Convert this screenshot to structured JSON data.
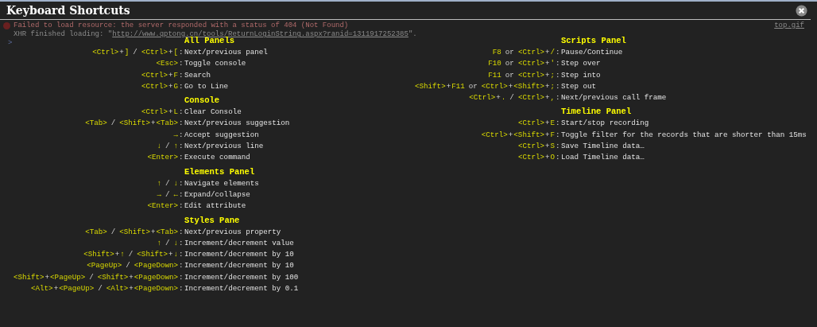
{
  "console": {
    "messages": [
      {
        "kind": "error",
        "text": "Failed to load resource: the server responded with a status of 404 (Not Found)",
        "source": "top.gif"
      },
      {
        "kind": "log",
        "text": "XHR finished loading: \"",
        "link": "http://www.qptong.cn/tools/ReturnLoginString.aspx?ranid=1311917252385",
        "after": "\"."
      }
    ],
    "prompt": ">"
  },
  "dialog": {
    "title": "Keyboard Shortcuts",
    "columns": [
      {
        "sections": [
          {
            "title": "All Panels",
            "shortcuts": [
              {
                "keys": [
                  {
                    "kind": "key",
                    "text": "<Ctrl>"
                  },
                  {
                    "kind": "sep",
                    "text": "+"
                  },
                  {
                    "kind": "key",
                    "text": "]"
                  },
                  {
                    "kind": "word",
                    "text": "/"
                  },
                  {
                    "kind": "key",
                    "text": "<Ctrl>"
                  },
                  {
                    "kind": "sep",
                    "text": "+"
                  },
                  {
                    "kind": "key",
                    "text": "["
                  }
                ],
                "separator": ":",
                "description": "Next/previous panel"
              },
              {
                "keys": [
                  {
                    "kind": "key",
                    "text": "<Esc>"
                  }
                ],
                "separator": ":",
                "description": "Toggle console"
              },
              {
                "keys": [
                  {
                    "kind": "key",
                    "text": "<Ctrl>"
                  },
                  {
                    "kind": "sep",
                    "text": "+"
                  },
                  {
                    "kind": "key",
                    "text": "F"
                  }
                ],
                "separator": ":",
                "description": "Search"
              },
              {
                "keys": [
                  {
                    "kind": "key",
                    "text": "<Ctrl>"
                  },
                  {
                    "kind": "sep",
                    "text": "+"
                  },
                  {
                    "kind": "key",
                    "text": "G"
                  }
                ],
                "separator": ":",
                "description": "Go to Line"
              }
            ]
          },
          {
            "title": "Console",
            "shortcuts": [
              {
                "keys": [
                  {
                    "kind": "key",
                    "text": "<Ctrl>"
                  },
                  {
                    "kind": "sep",
                    "text": "+"
                  },
                  {
                    "kind": "key",
                    "text": "L"
                  }
                ],
                "separator": ":",
                "description": "Clear Console"
              },
              {
                "keys": [
                  {
                    "kind": "key",
                    "text": "<Tab>"
                  },
                  {
                    "kind": "word",
                    "text": "/"
                  },
                  {
                    "kind": "key",
                    "text": "<Shift>"
                  },
                  {
                    "kind": "sep",
                    "text": "+"
                  },
                  {
                    "kind": "key",
                    "text": "<Tab>"
                  }
                ],
                "separator": ":",
                "description": "Next/previous suggestion"
              },
              {
                "keys": [
                  {
                    "kind": "key",
                    "text": "→"
                  }
                ],
                "separator": ":",
                "description": "Accept suggestion"
              },
              {
                "keys": [
                  {
                    "kind": "key",
                    "text": "↓"
                  },
                  {
                    "kind": "word",
                    "text": "/"
                  },
                  {
                    "kind": "key",
                    "text": "↑"
                  }
                ],
                "separator": ":",
                "description": "Next/previous line"
              },
              {
                "keys": [
                  {
                    "kind": "key",
                    "text": "<Enter>"
                  }
                ],
                "separator": ":",
                "description": "Execute command"
              }
            ]
          },
          {
            "title": "Elements Panel",
            "shortcuts": [
              {
                "keys": [
                  {
                    "kind": "key",
                    "text": "↑"
                  },
                  {
                    "kind": "word",
                    "text": "/"
                  },
                  {
                    "kind": "key",
                    "text": "↓"
                  }
                ],
                "separator": ":",
                "description": "Navigate elements"
              },
              {
                "keys": [
                  {
                    "kind": "key",
                    "text": "→"
                  },
                  {
                    "kind": "word",
                    "text": "/"
                  },
                  {
                    "kind": "key",
                    "text": "←"
                  }
                ],
                "separator": ":",
                "description": "Expand/collapse"
              },
              {
                "keys": [
                  {
                    "kind": "key",
                    "text": "<Enter>"
                  }
                ],
                "separator": ":",
                "description": "Edit attribute"
              }
            ]
          },
          {
            "title": "Styles Pane",
            "shortcuts": [
              {
                "keys": [
                  {
                    "kind": "key",
                    "text": "<Tab>"
                  },
                  {
                    "kind": "word",
                    "text": "/"
                  },
                  {
                    "kind": "key",
                    "text": "<Shift>"
                  },
                  {
                    "kind": "sep",
                    "text": "+"
                  },
                  {
                    "kind": "key",
                    "text": "<Tab>"
                  }
                ],
                "separator": ":",
                "description": "Next/previous property"
              },
              {
                "keys": [
                  {
                    "kind": "key",
                    "text": "↑"
                  },
                  {
                    "kind": "word",
                    "text": "/"
                  },
                  {
                    "kind": "key",
                    "text": "↓"
                  }
                ],
                "separator": ":",
                "description": "Increment/decrement value"
              },
              {
                "keys": [
                  {
                    "kind": "key",
                    "text": "<Shift>"
                  },
                  {
                    "kind": "sep",
                    "text": "+"
                  },
                  {
                    "kind": "key",
                    "text": "↑"
                  },
                  {
                    "kind": "word",
                    "text": "/"
                  },
                  {
                    "kind": "key",
                    "text": "<Shift>"
                  },
                  {
                    "kind": "sep",
                    "text": "+"
                  },
                  {
                    "kind": "key",
                    "text": "↓"
                  }
                ],
                "separator": ":",
                "description": "Increment/decrement by 10"
              },
              {
                "keys": [
                  {
                    "kind": "key",
                    "text": "<PageUp>"
                  },
                  {
                    "kind": "word",
                    "text": "/"
                  },
                  {
                    "kind": "key",
                    "text": "<PageDown>"
                  }
                ],
                "separator": ":",
                "description": "Increment/decrement by 10"
              },
              {
                "keys": [
                  {
                    "kind": "key",
                    "text": "<Shift>"
                  },
                  {
                    "kind": "sep",
                    "text": "+"
                  },
                  {
                    "kind": "key",
                    "text": "<PageUp>"
                  },
                  {
                    "kind": "word",
                    "text": "/"
                  },
                  {
                    "kind": "key",
                    "text": "<Shift>"
                  },
                  {
                    "kind": "sep",
                    "text": "+"
                  },
                  {
                    "kind": "key",
                    "text": "<PageDown>"
                  }
                ],
                "separator": ":",
                "description": "Increment/decrement by 100"
              },
              {
                "keys": [
                  {
                    "kind": "key",
                    "text": "<Alt>"
                  },
                  {
                    "kind": "sep",
                    "text": "+"
                  },
                  {
                    "kind": "key",
                    "text": "<PageUp>"
                  },
                  {
                    "kind": "word",
                    "text": "/"
                  },
                  {
                    "kind": "key",
                    "text": "<Alt>"
                  },
                  {
                    "kind": "sep",
                    "text": "+"
                  },
                  {
                    "kind": "key",
                    "text": "<PageDown>"
                  }
                ],
                "separator": ":",
                "description": "Increment/decrement by 0.1"
              }
            ]
          }
        ]
      },
      {
        "sections": [
          {
            "title": "Scripts Panel",
            "shortcuts": [
              {
                "keys": [
                  {
                    "kind": "key",
                    "text": "F8"
                  },
                  {
                    "kind": "word",
                    "text": "or"
                  },
                  {
                    "kind": "key",
                    "text": "<Ctrl>"
                  },
                  {
                    "kind": "sep",
                    "text": "+"
                  },
                  {
                    "kind": "key",
                    "text": "/"
                  }
                ],
                "separator": ":",
                "description": "Pause/Continue"
              },
              {
                "keys": [
                  {
                    "kind": "key",
                    "text": "F10"
                  },
                  {
                    "kind": "word",
                    "text": "or"
                  },
                  {
                    "kind": "key",
                    "text": "<Ctrl>"
                  },
                  {
                    "kind": "sep",
                    "text": "+"
                  },
                  {
                    "kind": "key",
                    "text": "'"
                  }
                ],
                "separator": ":",
                "description": "Step over"
              },
              {
                "keys": [
                  {
                    "kind": "key",
                    "text": "F11"
                  },
                  {
                    "kind": "word",
                    "text": "or"
                  },
                  {
                    "kind": "key",
                    "text": "<Ctrl>"
                  },
                  {
                    "kind": "sep",
                    "text": "+"
                  },
                  {
                    "kind": "key",
                    "text": ";"
                  }
                ],
                "separator": ":",
                "description": "Step into"
              },
              {
                "keys": [
                  {
                    "kind": "key",
                    "text": "<Shift>"
                  },
                  {
                    "kind": "sep",
                    "text": "+"
                  },
                  {
                    "kind": "key",
                    "text": "F11"
                  },
                  {
                    "kind": "word",
                    "text": "or"
                  },
                  {
                    "kind": "key",
                    "text": "<Ctrl>"
                  },
                  {
                    "kind": "sep",
                    "text": "+"
                  },
                  {
                    "kind": "key",
                    "text": "<Shift>"
                  },
                  {
                    "kind": "sep",
                    "text": "+"
                  },
                  {
                    "kind": "key",
                    "text": ";"
                  }
                ],
                "separator": ":",
                "description": "Step out"
              },
              {
                "keys": [
                  {
                    "kind": "key",
                    "text": "<Ctrl>"
                  },
                  {
                    "kind": "sep",
                    "text": "+"
                  },
                  {
                    "kind": "key",
                    "text": "."
                  },
                  {
                    "kind": "word",
                    "text": "/"
                  },
                  {
                    "kind": "key",
                    "text": "<Ctrl>"
                  },
                  {
                    "kind": "sep",
                    "text": "+"
                  },
                  {
                    "kind": "key",
                    "text": ","
                  }
                ],
                "separator": ":",
                "description": "Next/previous call frame"
              }
            ]
          },
          {
            "title": "Timeline Panel",
            "shortcuts": [
              {
                "keys": [
                  {
                    "kind": "key",
                    "text": "<Ctrl>"
                  },
                  {
                    "kind": "sep",
                    "text": "+"
                  },
                  {
                    "kind": "key",
                    "text": "E"
                  }
                ],
                "separator": ":",
                "description": "Start/stop recording"
              },
              {
                "keys": [
                  {
                    "kind": "key",
                    "text": "<Ctrl>"
                  },
                  {
                    "kind": "sep",
                    "text": "+"
                  },
                  {
                    "kind": "key",
                    "text": "<Shift>"
                  },
                  {
                    "kind": "sep",
                    "text": "+"
                  },
                  {
                    "kind": "key",
                    "text": "F"
                  }
                ],
                "separator": ":",
                "description": "Toggle filter for the records that are shorter than 15ms"
              },
              {
                "keys": [
                  {
                    "kind": "key",
                    "text": "<Ctrl>"
                  },
                  {
                    "kind": "sep",
                    "text": "+"
                  },
                  {
                    "kind": "key",
                    "text": "S"
                  }
                ],
                "separator": ":",
                "description": "Save Timeline data…"
              },
              {
                "keys": [
                  {
                    "kind": "key",
                    "text": "<Ctrl>"
                  },
                  {
                    "kind": "sep",
                    "text": "+"
                  },
                  {
                    "kind": "key",
                    "text": "O"
                  }
                ],
                "separator": ":",
                "description": "Load Timeline data…"
              }
            ]
          }
        ]
      }
    ]
  }
}
